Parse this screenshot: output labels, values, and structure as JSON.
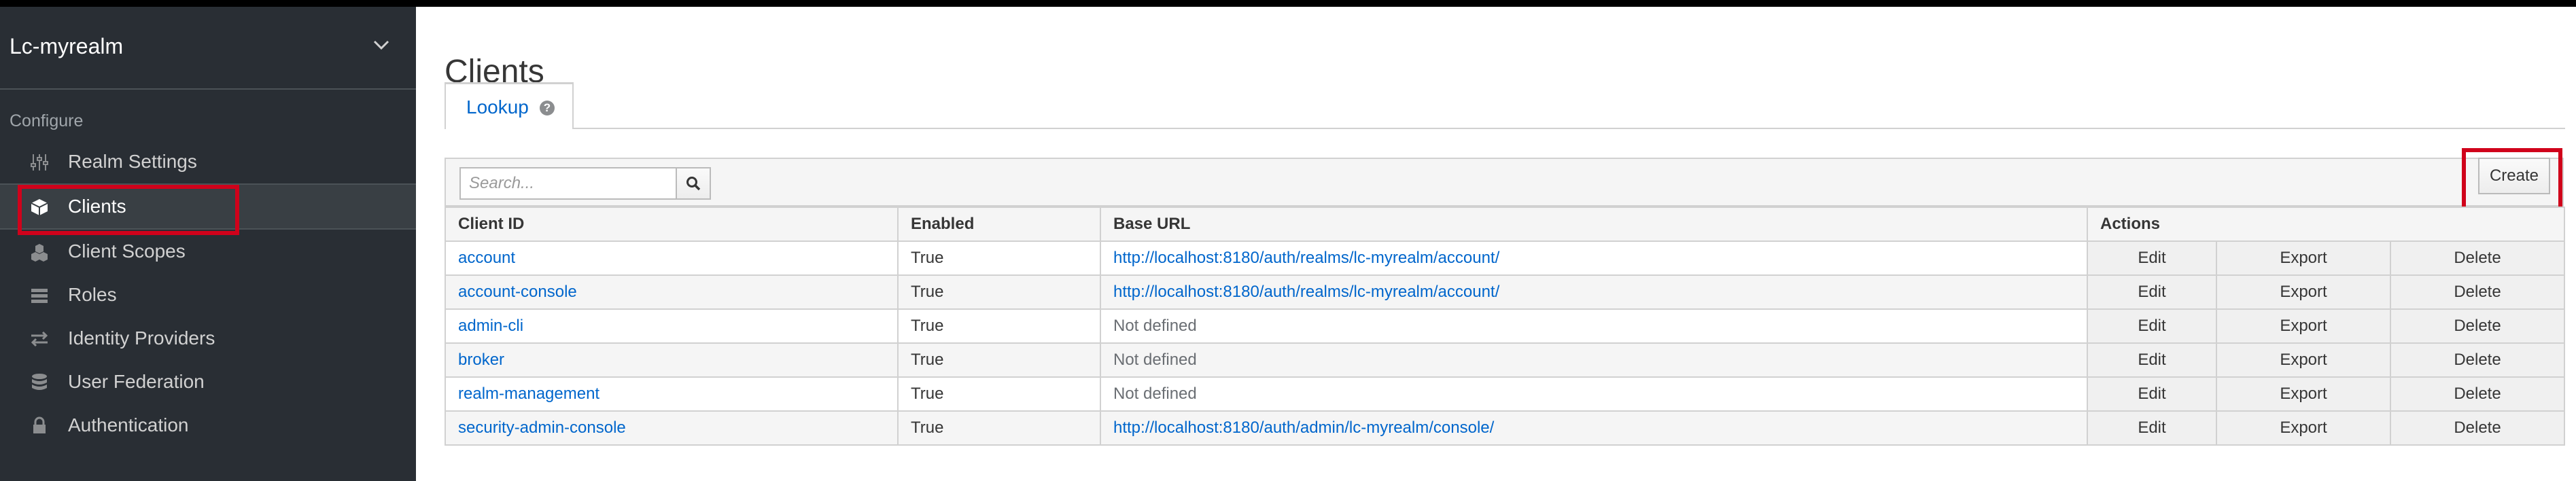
{
  "sidebar": {
    "realm_name": "Lc-myrealm",
    "section_label": "Configure",
    "items": [
      {
        "label": "Realm Settings",
        "icon": "sliders-icon",
        "active": false
      },
      {
        "label": "Clients",
        "icon": "cube-icon",
        "active": true
      },
      {
        "label": "Client Scopes",
        "icon": "cubes-icon",
        "active": false
      },
      {
        "label": "Roles",
        "icon": "list-icon",
        "active": false
      },
      {
        "label": "Identity Providers",
        "icon": "exchange-icon",
        "active": false
      },
      {
        "label": "User Federation",
        "icon": "database-icon",
        "active": false
      },
      {
        "label": "Authentication",
        "icon": "lock-icon",
        "active": false
      }
    ]
  },
  "main": {
    "title": "Clients",
    "tabs": [
      {
        "label": "Lookup",
        "help": "?"
      }
    ],
    "search": {
      "placeholder": "Search...",
      "value": ""
    },
    "create_label": "Create",
    "table": {
      "headers": {
        "client_id": "Client ID",
        "enabled": "Enabled",
        "base_url": "Base URL",
        "actions": "Actions"
      },
      "action_labels": {
        "edit": "Edit",
        "export": "Export",
        "delete": "Delete"
      },
      "rows": [
        {
          "client_id": "account",
          "enabled": "True",
          "base_url": "http://localhost:8180/auth/realms/lc-myrealm/account/"
        },
        {
          "client_id": "account-console",
          "enabled": "True",
          "base_url": "http://localhost:8180/auth/realms/lc-myrealm/account/"
        },
        {
          "client_id": "admin-cli",
          "enabled": "True",
          "base_url": "Not defined"
        },
        {
          "client_id": "broker",
          "enabled": "True",
          "base_url": "Not defined"
        },
        {
          "client_id": "realm-management",
          "enabled": "True",
          "base_url": "Not defined"
        },
        {
          "client_id": "security-admin-console",
          "enabled": "True",
          "base_url": "http://localhost:8180/auth/admin/lc-myrealm/console/"
        }
      ]
    }
  },
  "colors": {
    "sidebar_bg": "#292e34",
    "link": "#0066cc",
    "highlight": "#d0021b"
  }
}
